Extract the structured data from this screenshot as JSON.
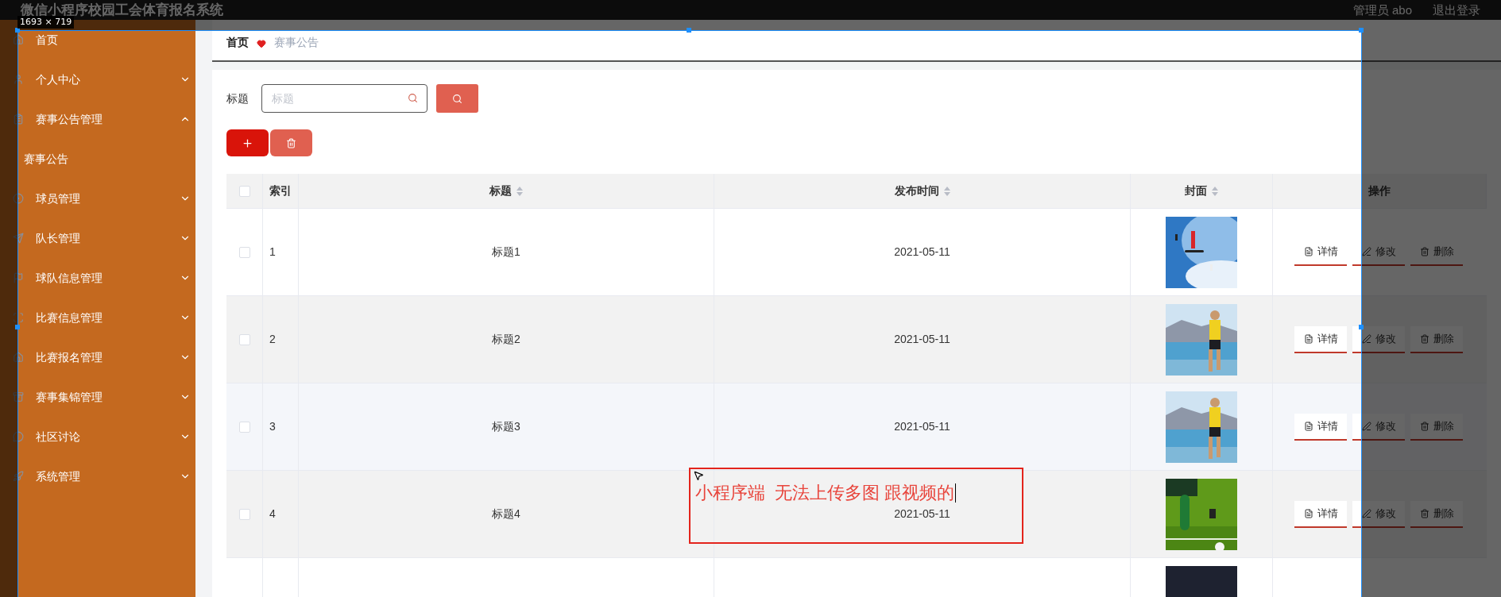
{
  "header": {
    "title": "微信小程序校园工会体育报名系统",
    "user": "管理员 abo",
    "logout": "退出登录"
  },
  "sidebar": {
    "items": [
      {
        "label": "首页",
        "kind": "link"
      },
      {
        "label": "个人中心",
        "kind": "menu",
        "expanded": false
      },
      {
        "label": "赛事公告管理",
        "kind": "menu",
        "expanded": true,
        "children": [
          {
            "label": "赛事公告"
          }
        ]
      },
      {
        "label": "球员管理",
        "kind": "menu",
        "expanded": false
      },
      {
        "label": "队长管理",
        "kind": "menu",
        "expanded": false
      },
      {
        "label": "球队信息管理",
        "kind": "menu",
        "expanded": false
      },
      {
        "label": "比赛信息管理",
        "kind": "menu",
        "expanded": false
      },
      {
        "label": "比赛报名管理",
        "kind": "menu",
        "expanded": false
      },
      {
        "label": "赛事集锦管理",
        "kind": "menu",
        "expanded": false
      },
      {
        "label": "社区讨论",
        "kind": "menu",
        "expanded": false
      },
      {
        "label": "系统管理",
        "kind": "menu",
        "expanded": false
      }
    ]
  },
  "breadcrumb": [
    "首页",
    "赛事公告"
  ],
  "search": {
    "label": "标题",
    "placeholder": "标题"
  },
  "table": {
    "select_all_checked": false,
    "columns": [
      {
        "label": "索引",
        "sortable": false
      },
      {
        "label": "标题",
        "sortable": true
      },
      {
        "label": "发布时间",
        "sortable": true
      },
      {
        "label": "封面",
        "sortable": true
      },
      {
        "label": "操作",
        "sortable": false
      }
    ],
    "rows": [
      {
        "checked": false,
        "index": "1",
        "title": "标题1",
        "date": "2021-05-11",
        "cover": {
          "kind": "picture"
        },
        "actions": [
          "详情",
          "修改",
          "删除"
        ]
      },
      {
        "checked": false,
        "index": "2",
        "title": "标题2",
        "date": "2021-05-11",
        "cover": {
          "kind": "picture"
        },
        "actions": [
          "详情",
          "修改",
          "删除"
        ]
      },
      {
        "checked": false,
        "index": "3",
        "title": "标题3",
        "date": "2021-05-11",
        "cover": {
          "kind": "picture"
        },
        "actions": [
          "详情",
          "修改",
          "删除"
        ]
      },
      {
        "checked": false,
        "index": "4",
        "title": "标题4",
        "date": "2021-05-11",
        "cover": {
          "kind": "picture"
        },
        "actions": [
          "详情",
          "修改",
          "删除"
        ]
      },
      {
        "cover": {
          "kind": "picture"
        }
      }
    ]
  },
  "screen_capture": {
    "size_label": "1693 × 719"
  },
  "annotation": {
    "text": "小程序端  无法上传多图 跟视频的"
  }
}
